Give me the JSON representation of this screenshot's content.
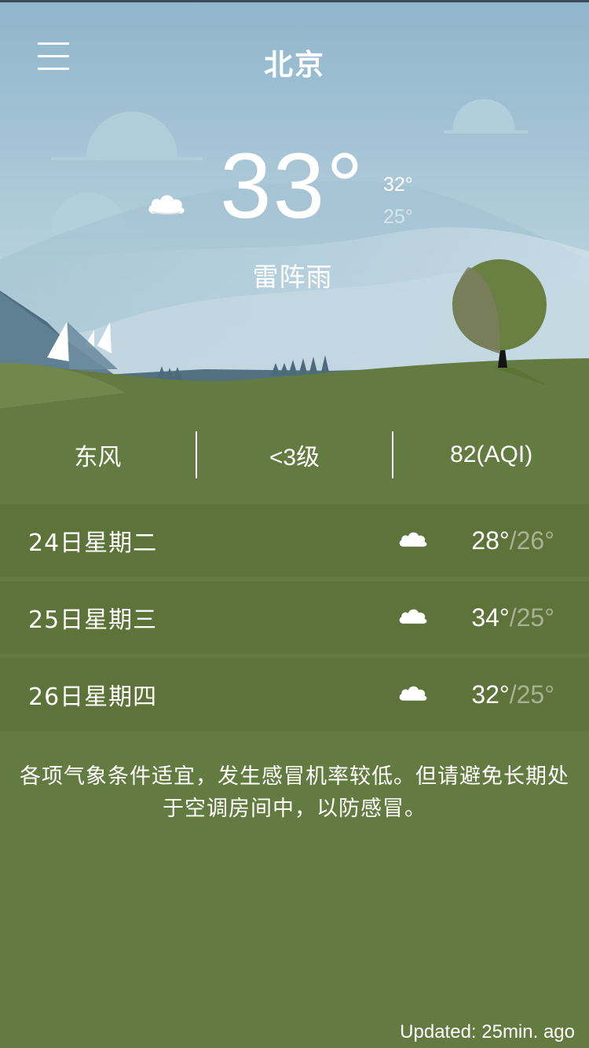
{
  "header": {
    "city": "北京",
    "menu_icon": "hamburger-menu-icon"
  },
  "current": {
    "temperature": "33°",
    "high": "32°",
    "low": "25°",
    "condition": "雷阵雨",
    "icon": "cloud-icon"
  },
  "stats": {
    "wind_direction": "东风",
    "wind_level": "<3级",
    "aqi": "82(AQI)"
  },
  "forecast": [
    {
      "day": "24日星期二",
      "icon": "cloud-icon",
      "high": "28°",
      "separator": "/",
      "low": "26°"
    },
    {
      "day": "25日星期三",
      "icon": "cloud-icon",
      "high": "34°",
      "separator": "/",
      "low": "25°"
    },
    {
      "day": "26日星期四",
      "icon": "cloud-icon",
      "high": "32°",
      "separator": "/",
      "low": "25°"
    }
  ],
  "advice": "各项气象条件适宜，发生感冒机率较低。但请避免长期处于空调房间中，以防感冒。",
  "updated": "Updated: 25min. ago",
  "colors": {
    "sky_top": "#8fb6cc",
    "sky_bottom": "#c9dde6",
    "grass": "#637b40",
    "forecast_row": "#5e7339",
    "tree": "#6a8042"
  }
}
